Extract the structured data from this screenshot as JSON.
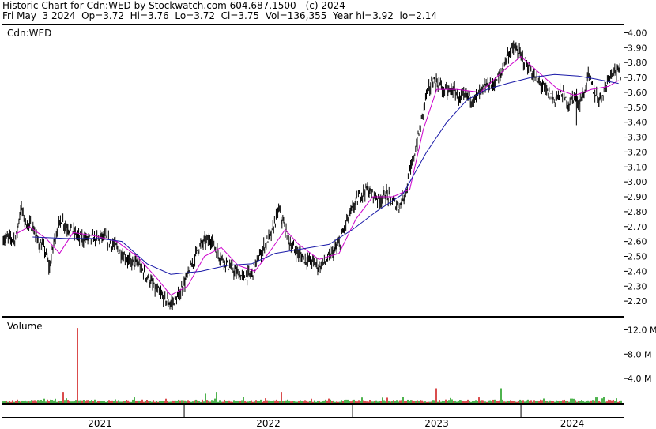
{
  "header": {
    "title_line": "Historic Chart for Cdn:WED by Stockwatch.com 604.687.1500 - (c) 2024",
    "quote_line": "Fri May  3 2024  Op=3.72  Hi=3.76  Lo=3.72  Cl=3.75  Vol=136,355  Year hi=3.92  lo=2.14"
  },
  "price_panel": {
    "symbol_label": "Cdn:WED"
  },
  "volume_panel": {
    "label": "Volume"
  },
  "colors": {
    "price_bars": "#000000",
    "short_ma": "#cc00cc",
    "long_ma": "#1a1aa8",
    "volume_up": "#22a022",
    "volume_down": "#d02020",
    "frame": "#000000",
    "grid": "#000000"
  },
  "chart_data": [
    {
      "type": "line",
      "name": "price",
      "ylim": [
        2.1,
        4.05
      ],
      "yticks": [
        "4.00",
        "3.90",
        "3.80",
        "3.70",
        "3.60",
        "3.50",
        "3.40",
        "3.30",
        "3.20",
        "3.10",
        "3.00",
        "2.90",
        "2.80",
        "2.70",
        "2.60",
        "2.50",
        "2.40",
        "2.30",
        "2.20"
      ],
      "xlabels": [
        "2021",
        "2022",
        "2023",
        "2024"
      ],
      "series": [
        {
          "values": [
            [
              2021.0,
              2.62
            ],
            [
              2021.03,
              2.83
            ],
            [
              2021.06,
              2.72
            ],
            [
              2021.1,
              2.7
            ],
            [
              2021.13,
              2.6
            ],
            [
              2021.17,
              2.55
            ],
            [
              2021.2,
              2.42
            ],
            [
              2021.23,
              2.62
            ],
            [
              2021.27,
              2.75
            ],
            [
              2021.3,
              2.7
            ],
            [
              2021.33,
              2.68
            ],
            [
              2021.38,
              2.62
            ],
            [
              2021.45,
              2.62
            ],
            [
              2021.52,
              2.63
            ],
            [
              2021.58,
              2.58
            ],
            [
              2021.63,
              2.52
            ],
            [
              2021.68,
              2.46
            ],
            [
              2021.73,
              2.45
            ],
            [
              2021.78,
              2.36
            ],
            [
              2021.83,
              2.28
            ],
            [
              2021.88,
              2.22
            ],
            [
              2021.92,
              2.18
            ],
            [
              2021.96,
              2.22
            ],
            [
              2022.0,
              2.32
            ],
            [
              2022.04,
              2.42
            ],
            [
              2022.08,
              2.55
            ],
            [
              2022.12,
              2.6
            ],
            [
              2022.16,
              2.62
            ],
            [
              2022.2,
              2.52
            ],
            [
              2022.25,
              2.45
            ],
            [
              2022.3,
              2.4
            ],
            [
              2022.35,
              2.36
            ],
            [
              2022.4,
              2.38
            ],
            [
              2022.44,
              2.48
            ],
            [
              2022.48,
              2.58
            ],
            [
              2022.52,
              2.65
            ],
            [
              2022.56,
              2.82
            ],
            [
              2022.6,
              2.68
            ],
            [
              2022.64,
              2.56
            ],
            [
              2022.68,
              2.52
            ],
            [
              2022.72,
              2.48
            ],
            [
              2022.76,
              2.47
            ],
            [
              2022.8,
              2.43
            ],
            [
              2022.84,
              2.47
            ],
            [
              2022.88,
              2.52
            ],
            [
              2022.92,
              2.58
            ],
            [
              2022.96,
              2.72
            ],
            [
              2023.0,
              2.82
            ],
            [
              2023.04,
              2.9
            ],
            [
              2023.08,
              2.95
            ],
            [
              2023.12,
              2.92
            ],
            [
              2023.16,
              2.88
            ],
            [
              2023.2,
              2.92
            ],
            [
              2023.24,
              2.86
            ],
            [
              2023.28,
              2.84
            ],
            [
              2023.32,
              2.95
            ],
            [
              2023.36,
              3.15
            ],
            [
              2023.4,
              3.35
            ],
            [
              2023.44,
              3.6
            ],
            [
              2023.48,
              3.68
            ],
            [
              2023.52,
              3.65
            ],
            [
              2023.56,
              3.6
            ],
            [
              2023.6,
              3.62
            ],
            [
              2023.64,
              3.55
            ],
            [
              2023.68,
              3.58
            ],
            [
              2023.72,
              3.55
            ],
            [
              2023.76,
              3.6
            ],
            [
              2023.8,
              3.65
            ],
            [
              2023.84,
              3.66
            ],
            [
              2023.88,
              3.72
            ],
            [
              2023.92,
              3.85
            ],
            [
              2023.96,
              3.9
            ],
            [
              2024.0,
              3.84
            ],
            [
              2024.04,
              3.78
            ],
            [
              2024.08,
              3.7
            ],
            [
              2024.12,
              3.65
            ],
            [
              2024.16,
              3.6
            ],
            [
              2024.2,
              3.55
            ],
            [
              2024.24,
              3.6
            ],
            [
              2024.28,
              3.52
            ],
            [
              2024.31,
              3.57
            ],
            [
              2024.35,
              3.54
            ],
            [
              2024.38,
              3.6
            ],
            [
              2024.4,
              3.72
            ],
            [
              2024.43,
              3.62
            ],
            [
              2024.46,
              3.55
            ],
            [
              2024.49,
              3.6
            ],
            [
              2024.52,
              3.7
            ],
            [
              2024.55,
              3.76
            ],
            [
              2024.58,
              3.73
            ]
          ]
        },
        {
          "name": "short_ma",
          "values": [
            [
              2021.0,
              2.65
            ],
            [
              2021.08,
              2.7
            ],
            [
              2021.18,
              2.62
            ],
            [
              2021.26,
              2.52
            ],
            [
              2021.34,
              2.66
            ],
            [
              2021.46,
              2.64
            ],
            [
              2021.6,
              2.6
            ],
            [
              2021.72,
              2.5
            ],
            [
              2021.84,
              2.35
            ],
            [
              2021.92,
              2.24
            ],
            [
              2022.02,
              2.3
            ],
            [
              2022.12,
              2.5
            ],
            [
              2022.22,
              2.56
            ],
            [
              2022.32,
              2.44
            ],
            [
              2022.42,
              2.4
            ],
            [
              2022.52,
              2.55
            ],
            [
              2022.6,
              2.68
            ],
            [
              2022.68,
              2.58
            ],
            [
              2022.8,
              2.48
            ],
            [
              2022.92,
              2.52
            ],
            [
              2023.02,
              2.75
            ],
            [
              2023.12,
              2.9
            ],
            [
              2023.24,
              2.9
            ],
            [
              2023.34,
              2.95
            ],
            [
              2023.42,
              3.35
            ],
            [
              2023.5,
              3.62
            ],
            [
              2023.62,
              3.62
            ],
            [
              2023.76,
              3.6
            ],
            [
              2023.9,
              3.75
            ],
            [
              2024.0,
              3.84
            ],
            [
              2024.1,
              3.74
            ],
            [
              2024.22,
              3.62
            ],
            [
              2024.32,
              3.58
            ],
            [
              2024.42,
              3.62
            ],
            [
              2024.52,
              3.64
            ],
            [
              2024.58,
              3.68
            ]
          ]
        },
        {
          "name": "long_ma",
          "values": [
            [
              2021.1,
              2.63
            ],
            [
              2021.3,
              2.62
            ],
            [
              2021.5,
              2.62
            ],
            [
              2021.63,
              2.6
            ],
            [
              2021.78,
              2.45
            ],
            [
              2021.92,
              2.38
            ],
            [
              2022.1,
              2.4
            ],
            [
              2022.26,
              2.44
            ],
            [
              2022.4,
              2.45
            ],
            [
              2022.54,
              2.52
            ],
            [
              2022.7,
              2.55
            ],
            [
              2022.86,
              2.58
            ],
            [
              2023.0,
              2.68
            ],
            [
              2023.14,
              2.8
            ],
            [
              2023.3,
              2.92
            ],
            [
              2023.44,
              3.2
            ],
            [
              2023.56,
              3.4
            ],
            [
              2023.68,
              3.55
            ],
            [
              2023.8,
              3.62
            ],
            [
              2023.92,
              3.66
            ],
            [
              2024.06,
              3.7
            ],
            [
              2024.2,
              3.72
            ],
            [
              2024.34,
              3.71
            ],
            [
              2024.44,
              3.69
            ],
            [
              2024.58,
              3.66
            ]
          ]
        }
      ]
    },
    {
      "type": "bar",
      "name": "volume",
      "ylim": [
        0,
        14000000
      ],
      "yticks": [
        "12.0 M",
        "8.0 M",
        "4.0 M"
      ],
      "spikes": [
        [
          2021.37,
          12300000
        ],
        [
          2021.28,
          1800000
        ],
        [
          2021.7,
          900000
        ],
        [
          2022.13,
          1500000
        ],
        [
          2022.19,
          1800000
        ],
        [
          2022.58,
          1800000
        ],
        [
          2022.86,
          700000
        ],
        [
          2023.3,
          1000000
        ],
        [
          2023.5,
          2400000
        ],
        [
          2023.58,
          800000
        ],
        [
          2023.75,
          900000
        ],
        [
          2023.88,
          2400000
        ],
        [
          2024.3,
          700000
        ],
        [
          2024.45,
          900000
        ]
      ]
    }
  ]
}
